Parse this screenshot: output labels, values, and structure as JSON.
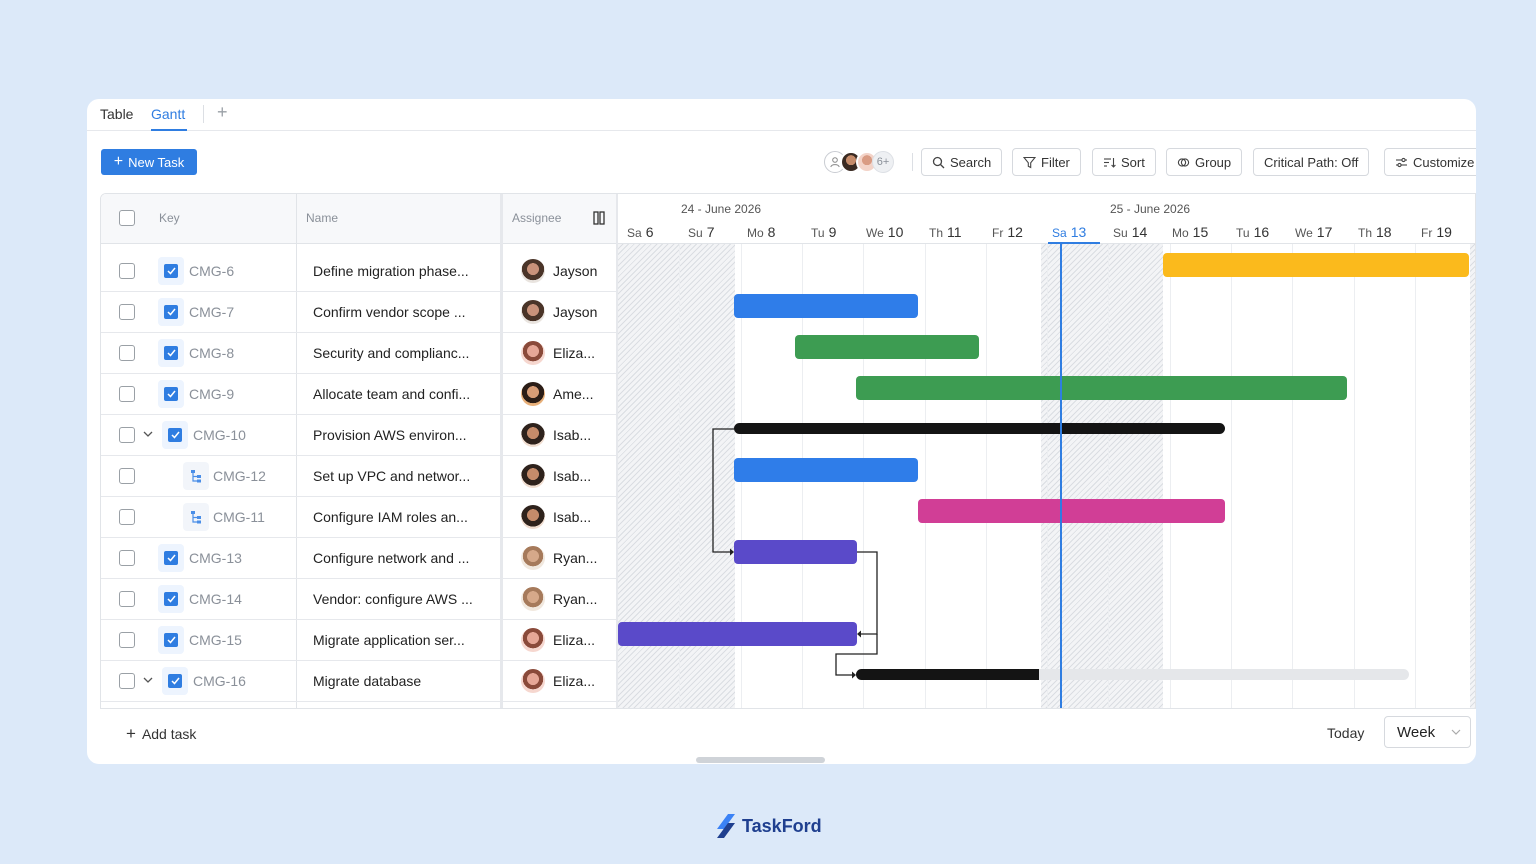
{
  "tabs": [
    {
      "label": "Table"
    },
    {
      "label": "Gantt",
      "active": true
    }
  ],
  "toolbar": {
    "new_task": "New Task",
    "more_avatars": "6+",
    "search": "Search",
    "filter": "Filter",
    "sort": "Sort",
    "group": "Group",
    "critical_path": "Critical Path: Off",
    "customize": "Customize"
  },
  "table": {
    "headers": {
      "key": "Key",
      "name": "Name",
      "assignee": "Assignee"
    },
    "rows": [
      {
        "key": "CMG-6",
        "name": "Define migration phase...",
        "assignee": "Jayson"
      },
      {
        "key": "CMG-7",
        "name": "Confirm vendor scope ...",
        "assignee": "Jayson"
      },
      {
        "key": "CMG-8",
        "name": "Security and complianc...",
        "assignee": "Eliza..."
      },
      {
        "key": "CMG-9",
        "name": "Allocate team and confi...",
        "assignee": "Ame..."
      },
      {
        "key": "CMG-10",
        "name": "Provision AWS environ...",
        "assignee": "Isab..."
      },
      {
        "key": "CMG-12",
        "name": "Set up VPC and networ...",
        "assignee": "Isab..."
      },
      {
        "key": "CMG-11",
        "name": "Configure IAM roles an...",
        "assignee": "Isab..."
      },
      {
        "key": "CMG-13",
        "name": "Configure network and ...",
        "assignee": "Ryan..."
      },
      {
        "key": "CMG-14",
        "name": "Vendor: configure AWS ...",
        "assignee": "Ryan..."
      },
      {
        "key": "CMG-15",
        "name": "Migrate application ser...",
        "assignee": "Eliza..."
      },
      {
        "key": "CMG-16",
        "name": "Migrate database",
        "assignee": "Eliza..."
      }
    ]
  },
  "gantt": {
    "weeks": [
      "24 - June 2026",
      "25 - June 2026"
    ],
    "days": [
      {
        "dow": "Sa",
        "num": "6"
      },
      {
        "dow": "Su",
        "num": "7"
      },
      {
        "dow": "Mo",
        "num": "8"
      },
      {
        "dow": "Tu",
        "num": "9"
      },
      {
        "dow": "We",
        "num": "10"
      },
      {
        "dow": "Th",
        "num": "11"
      },
      {
        "dow": "Fr",
        "num": "12"
      },
      {
        "dow": "Sa",
        "num": "13",
        "today": true
      },
      {
        "dow": "Su",
        "num": "14"
      },
      {
        "dow": "Mo",
        "num": "15"
      },
      {
        "dow": "Tu",
        "num": "16"
      },
      {
        "dow": "We",
        "num": "17"
      },
      {
        "dow": "Th",
        "num": "18"
      },
      {
        "dow": "Fr",
        "num": "19"
      }
    ],
    "colors": {
      "yellow": "#fbba1c",
      "blue": "#2f7de9",
      "green": "#3d9c52",
      "black": "#141414",
      "magenta": "#d13e96",
      "purple": "#5a4ac9",
      "today": "#2f7de1"
    }
  },
  "footer": {
    "add_task": "Add task",
    "today": "Today",
    "view": "Week"
  },
  "brand": {
    "name": "TaskFord"
  }
}
